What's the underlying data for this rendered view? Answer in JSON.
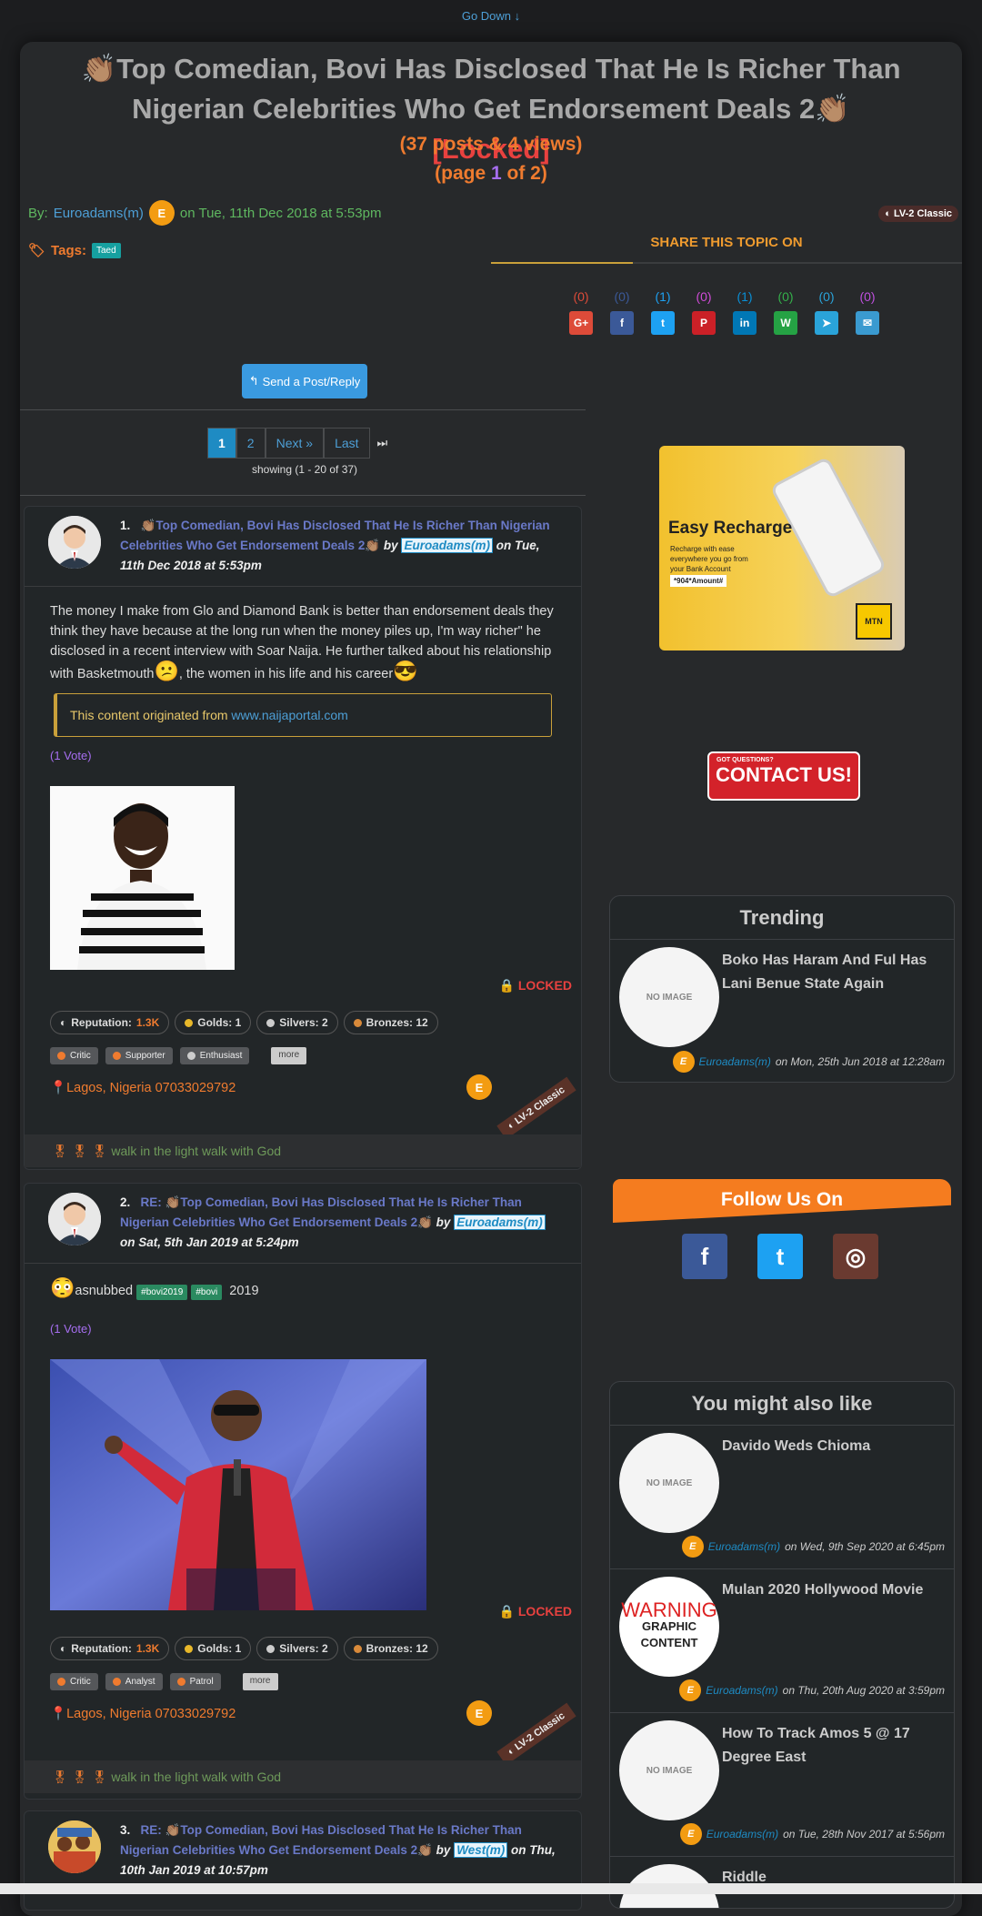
{
  "top": {
    "go_down": "Go Down ↓"
  },
  "topic": {
    "emoji": "👏🏽",
    "title": "Top Comedian, Bovi Has Disclosed That He Is Richer Than Nigerian Celebrities Who Get Endorsement Deals 2",
    "locked_tag": "[Locked]",
    "posts_views": "(37 posts & 4 views)",
    "page_prefix": "(page ",
    "page_current": "1",
    "page_suffix": " of 2)",
    "by_label": "By:",
    "author": "Euroadams(m)",
    "author_initial": "E",
    "date": "on Tue, 11th Dec 2018 at 5:53pm",
    "level_badge": "LV-2 Classic",
    "tags_label": "Tags:",
    "tag": "Taed"
  },
  "share": {
    "title": "SHARE THIS TOPIC ON",
    "items": [
      {
        "count": "(0)",
        "icon": "google-plus-icon",
        "glyph": "G+",
        "color": "#dd4b39",
        "count_color": "#dd4b39"
      },
      {
        "count": "(0)",
        "icon": "facebook-icon",
        "glyph": "f",
        "color": "#3b5998",
        "count_color": "#3b5998"
      },
      {
        "count": "(1)",
        "icon": "twitter-icon",
        "glyph": "t",
        "color": "#1da1f2",
        "count_color": "#1da1f2"
      },
      {
        "count": "(0)",
        "icon": "pinterest-icon",
        "glyph": "P",
        "color": "#cb2027",
        "count_color": "#d04bd8"
      },
      {
        "count": "(1)",
        "icon": "linkedin-icon",
        "glyph": "in",
        "color": "#0077b5",
        "count_color": "#0a8fd6"
      },
      {
        "count": "(0)",
        "icon": "whatsapp-icon",
        "glyph": "W",
        "color": "#25a244",
        "count_color": "#34b04a"
      },
      {
        "count": "(0)",
        "icon": "telegram-icon",
        "glyph": "➤",
        "color": "#2aa3d9",
        "count_color": "#2aa3d9"
      },
      {
        "count": "(0)",
        "icon": "email-icon",
        "glyph": "✉",
        "color": "#3a9ad0",
        "count_color": "#c050e0"
      }
    ]
  },
  "actions": {
    "send_reply": "Send a Post/Reply"
  },
  "pager": {
    "p1": "1",
    "p2": "2",
    "next": "Next »",
    "last": "Last",
    "end": "⏭",
    "showing": "showing (1 - 20 of 37)"
  },
  "posts": [
    {
      "num": "1.",
      "prefix": "",
      "title": "Top Comedian, Bovi Has Disclosed That He Is Richer Than Nigerian Celebrities Who Get Endorsement Deals 2",
      "by": "by",
      "user": "Euroadams(m)",
      "date": "on Tue, 11th Dec 2018 at 5:53pm",
      "body": "The money I make from Glo and Diamond Bank is better than endorsement deals they think they have because at the long run when the money piles up, I'm way richer\" he disclosed in a recent interview with Soar Naija. He further talked about his relationship with Basketmouth",
      "body_mid": ", the women in his life and his career",
      "quote_prefix": "This content originated from ",
      "quote_link": "www.naijaportal.com",
      "vote": "1 Vote",
      "locked": "LOCKED",
      "reputation_label": "Reputation:",
      "reputation": "1.3K",
      "golds": "Golds: 1",
      "silvers": "Silvers: 2",
      "bronzes": "Bronzes: 12",
      "badges": [
        "Critic",
        "Supporter",
        "Enthusiast"
      ],
      "more": "more",
      "location": "Lagos, Nigeria 07033029792",
      "initial": "E",
      "level": "LV-2 Classic",
      "signature": "walk in the light walk with God"
    },
    {
      "num": "2.",
      "prefix": "RE: ",
      "title": "Top Comedian, Bovi Has Disclosed That He Is Richer Than Nigerian Celebrities Who Get Endorsement Deals 2",
      "by": "by",
      "user": "Euroadams(m)",
      "date": "on Sat, 5th Jan 2019 at 5:24pm",
      "body_user": "asnubbed",
      "tag1": "#bovi2019",
      "tag2": "#bovi",
      "body_year": "2019",
      "vote": "1 Vote",
      "locked": "LOCKED",
      "reputation_label": "Reputation:",
      "reputation": "1.3K",
      "golds": "Golds: 1",
      "silvers": "Silvers: 2",
      "bronzes": "Bronzes: 12",
      "badges": [
        "Critic",
        "Analyst",
        "Patrol"
      ],
      "more": "more",
      "location": "Lagos, Nigeria 07033029792",
      "initial": "E",
      "level": "LV-2 Classic",
      "signature": "walk in the light walk with God"
    },
    {
      "num": "3.",
      "prefix": "RE: ",
      "title": "Top Comedian, Bovi Has Disclosed That He Is Richer Than Nigerian Celebrities Who Get Endorsement Deals 2",
      "by": "by",
      "user": "West(m)",
      "date": "on Thu, 10th Jan 2019 at 10:57pm"
    }
  ],
  "ad": {
    "heading": "Easy Recharge",
    "text": "Recharge with ease everywhere you go from your Bank Account",
    "code": "*904*Amount#",
    "brand": "MTN"
  },
  "contact": {
    "small": "GOT QUESTIONS?",
    "label": "CONTACT US!"
  },
  "trending": {
    "title": "Trending",
    "items": [
      {
        "img": "NO IMAGE",
        "title": "Boko Has Haram And Ful Has Lani Benue State Again",
        "user": "Euroadams(m)",
        "date": "on Mon, 25th Jun 2018 at 12:28am",
        "initial": "E"
      }
    ]
  },
  "follow": {
    "title": "Follow Us On",
    "facebook": "f",
    "twitter": "t",
    "instagram": "◎"
  },
  "also_like": {
    "title": "You might also like",
    "items": [
      {
        "img": "NO IMAGE",
        "title": "Davido Weds Chioma",
        "user": "Euroadams(m)",
        "date": "on Wed, 9th Sep 2020 at 6:45pm",
        "initial": "E"
      },
      {
        "img_warn": "WARNING",
        "img_sub": "GRAPHIC CONTENT",
        "title": "Mulan 2020 Hollywood Movie",
        "user": "Euroadams(m)",
        "date": "on Thu, 20th Aug 2020 at 3:59pm",
        "initial": "E"
      },
      {
        "img": "NO IMAGE",
        "title": "How To Track Amos 5 @ 17 Degree East",
        "user": "Euroadams(m)",
        "date": "on Tue, 28th Nov 2017 at 5:56pm",
        "initial": "E"
      },
      {
        "title": "Riddle"
      }
    ]
  }
}
